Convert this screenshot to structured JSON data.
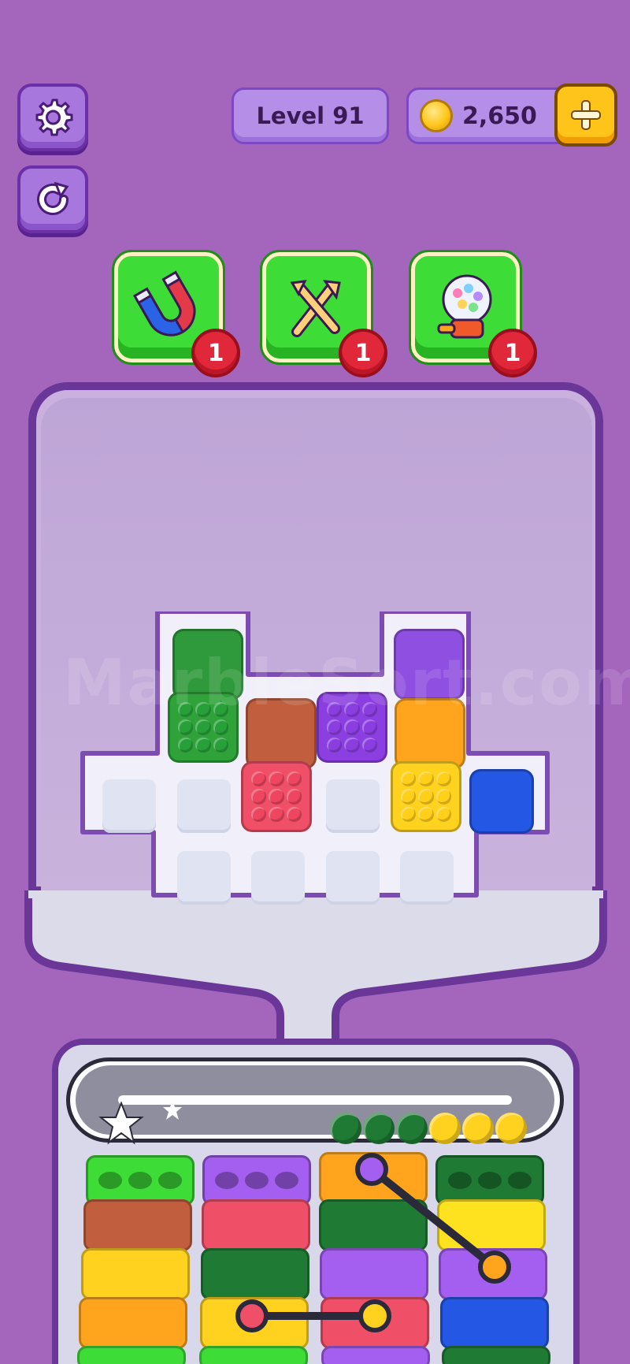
{
  "header": {
    "level_label": "Level 91",
    "coins": "2,650"
  },
  "icons": {
    "settings": "gear-icon",
    "restart": "restart-icon",
    "add_coins": "plus-icon"
  },
  "boosters": [
    {
      "name": "magnet",
      "icon": "magnet-icon",
      "count": "1"
    },
    {
      "name": "shuffle",
      "icon": "shuffle-arrows-icon",
      "count": "1"
    },
    {
      "name": "gumball",
      "icon": "gumball-machine-icon",
      "count": "1"
    }
  ],
  "watermark": "MarbleSort.com",
  "colors": {
    "background": "#a466bd",
    "booster_green": "#3ddc36",
    "coin_button": "#ffc41a",
    "badge_red": "#e0283a"
  },
  "board_blocks": [
    {
      "color": "#2f9a3c",
      "bubbles": false
    },
    {
      "color": "#8f4fe0",
      "bubbles": false
    },
    {
      "color": "#2fa33a",
      "bubbles": true
    },
    {
      "color": "#c05e3e",
      "bubbles": false
    },
    {
      "color": "#8b3fe0",
      "bubbles": true
    },
    {
      "color": "#ffa41c",
      "bubbles": false
    },
    {
      "color": "#ef4f67",
      "bubbles": true
    },
    {
      "color": "#ffd21f",
      "bubbles": true
    },
    {
      "color": "#2357e4",
      "bubbles": false
    }
  ],
  "conveyor_balls": [
    "#1f7a34",
    "#1f7a34",
    "#1f7a34",
    "#ffd21f",
    "#ffd21f",
    "#ffd21f"
  ]
}
